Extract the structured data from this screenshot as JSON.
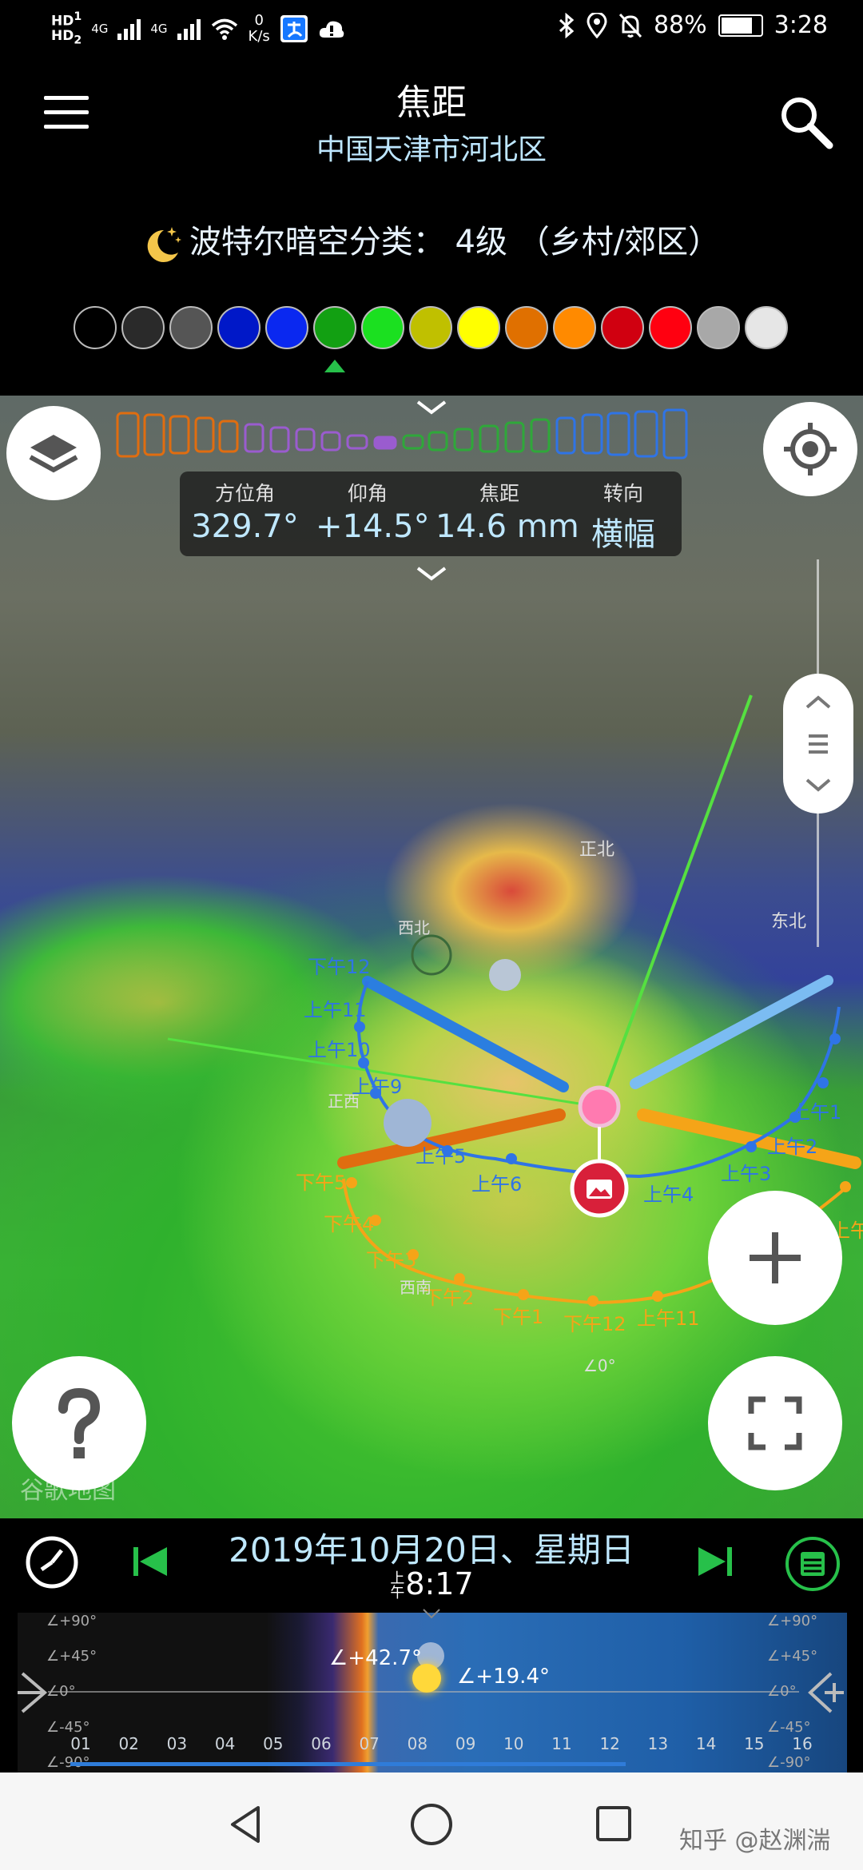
{
  "status_bar": {
    "hd1": "HD",
    "hd1_sub": "1",
    "hd2": "HD",
    "hd2_sub": "2",
    "net1": "4G",
    "net2": "4G",
    "speed_value": "0",
    "speed_unit": "K/s",
    "battery": "88%",
    "battery_level": 0.88,
    "time": "3:28"
  },
  "header": {
    "title": "焦距",
    "location": "中国天津市河北区",
    "bortle": "波特尔暗空分类： 4级 （乡村/郊区）"
  },
  "bortle_swatches": {
    "colors": [
      "#000000",
      "#2a2a2a",
      "#555555",
      "#0018c8",
      "#0a28f0",
      "#12a012",
      "#1be020",
      "#c0c000",
      "#ffff00",
      "#e07000",
      "#ff8a00",
      "#d00010",
      "#ff0010",
      "#a8a8a8",
      "#e6e6e6"
    ],
    "selected_index": 5
  },
  "info_panel": {
    "azimuth_label": "方位角",
    "azimuth_value": "329.7°",
    "elevation_label": "仰角",
    "elevation_value": "+14.5°",
    "focal_label": "焦距",
    "focal_value": "14.6 mm",
    "orient_label": "转向",
    "orient_value": "横幅"
  },
  "map": {
    "labels": {
      "pm12": "下午12",
      "am11_l": "上午11",
      "am10": "上午10",
      "am9": "上午9",
      "west": "正西",
      "am5": "上午5",
      "am6": "上午6",
      "am4": "上午4",
      "am3": "上午3",
      "am2": "上午2",
      "am1": "上午1",
      "pm5": "下午5",
      "pm4": "下午4",
      "pm3": "下午3",
      "pm2": "下午2",
      "pm1": "下午1",
      "pm12_b": "下午12",
      "am11_b": "上午11",
      "north": "正北",
      "northeast": "东北",
      "northwest": "西北",
      "southwest": "西南",
      "angle0": "∠0°",
      "am8": "上午8"
    },
    "watermark": "谷歌地图"
  },
  "date_bar": {
    "date": "2019年10月20日、星期日",
    "time_prefix": "上午",
    "time": "8:17"
  },
  "timeline": {
    "hours": [
      "01",
      "02",
      "03",
      "04",
      "05",
      "06",
      "07",
      "08",
      "09",
      "10",
      "11",
      "12",
      "13",
      "14",
      "15",
      "16"
    ],
    "angle_labels": [
      "∠+90°",
      "∠+45°",
      "∠0°",
      "∠-45°",
      "∠-90°"
    ],
    "moon_altitude": "∠+42.7°",
    "sun_altitude": "∠+19.4°"
  },
  "credit": "知乎 @赵渊湍"
}
